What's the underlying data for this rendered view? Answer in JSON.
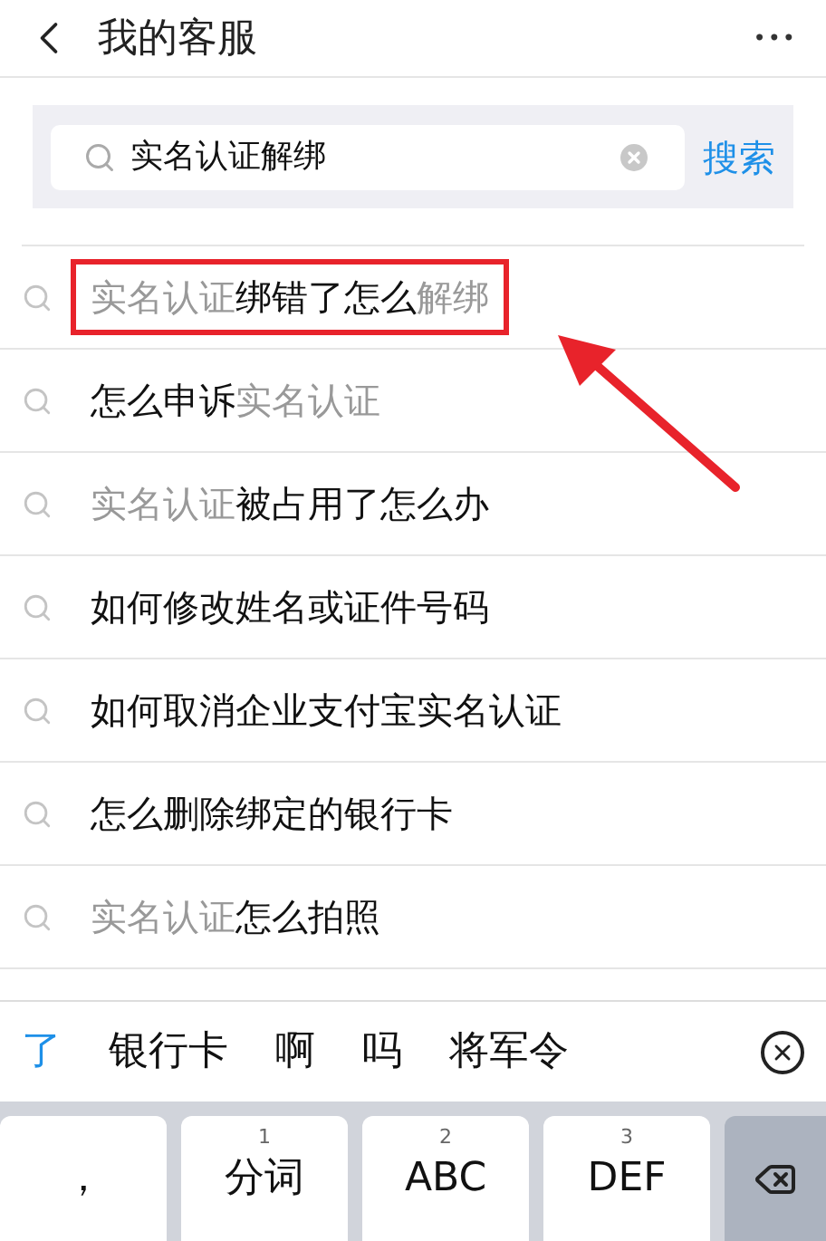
{
  "header": {
    "title": "我的客服",
    "more": "•••"
  },
  "search": {
    "value": "实名认证解绑",
    "button": "搜索"
  },
  "suggestions": [
    {
      "boxed": true,
      "parts": [
        {
          "text": "实名认证",
          "match": true
        },
        {
          "text": "绑错了怎么",
          "match": false
        },
        {
          "text": "解绑",
          "match": true
        }
      ]
    },
    {
      "boxed": false,
      "parts": [
        {
          "text": "怎么申诉",
          "match": false
        },
        {
          "text": "实名认证",
          "match": true
        }
      ]
    },
    {
      "boxed": false,
      "parts": [
        {
          "text": "实名认证",
          "match": true
        },
        {
          "text": "被占用了怎么办",
          "match": false
        }
      ]
    },
    {
      "boxed": false,
      "parts": [
        {
          "text": "如何修改姓名或证件号码",
          "match": false
        }
      ]
    },
    {
      "boxed": false,
      "parts": [
        {
          "text": "如何取消企业支付宝实名认证",
          "match": false
        }
      ]
    },
    {
      "boxed": false,
      "parts": [
        {
          "text": "怎么删除绑定的银行卡",
          "match": false
        }
      ]
    },
    {
      "boxed": false,
      "parts": [
        {
          "text": "实名认证",
          "match": true
        },
        {
          "text": "怎么拍照",
          "match": false
        }
      ]
    }
  ],
  "candidates": [
    {
      "text": "了",
      "selected": true
    },
    {
      "text": "银行卡",
      "selected": false
    },
    {
      "text": "啊",
      "selected": false
    },
    {
      "text": "吗",
      "selected": false
    },
    {
      "text": "将军令",
      "selected": false
    }
  ],
  "keys": [
    {
      "label": "，"
    },
    {
      "number": "1",
      "label": "分词"
    },
    {
      "number": "2",
      "label": "ABC"
    },
    {
      "number": "3",
      "label": "DEF"
    }
  ]
}
